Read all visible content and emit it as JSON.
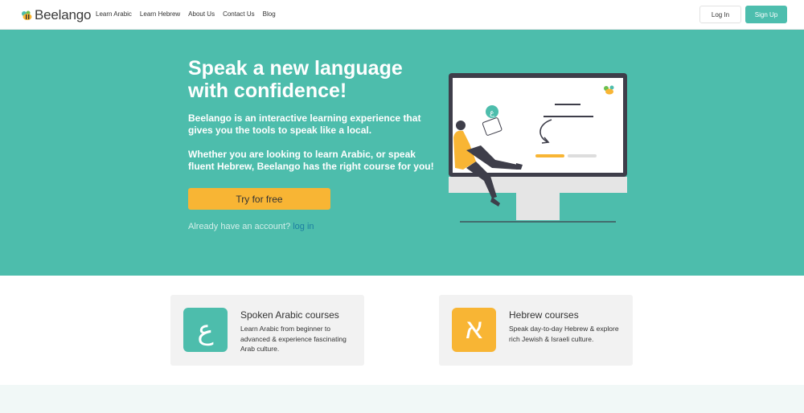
{
  "brand": {
    "name": "Beelango"
  },
  "nav": {
    "links": [
      "Learn Arabic",
      "Learn Hebrew",
      "About Us",
      "Contact Us",
      "Blog"
    ],
    "login_label": "Log In",
    "signup_label": "Sign Up"
  },
  "hero": {
    "title": "Speak a new language with confidence!",
    "paragraph1": "Beelango is an interactive learning experience that gives you the tools to speak like a local.",
    "paragraph2": "Whether you are looking to learn Arabic, or speak fluent Hebrew, Beelango has the right course for you!",
    "cta_label": "Try for free",
    "account_text": "Already have an account?",
    "login_link": "log in",
    "illustration_glyph": "ع"
  },
  "courses": [
    {
      "glyph": "ع",
      "title": "Spoken Arabic courses",
      "description": "Learn Arabic from beginner to advanced & experience fascinating Arab culture."
    },
    {
      "glyph": "א",
      "title": "Hebrew courses",
      "description": "Speak day-to-day Hebrew & explore rich Jewish & Israeli culture."
    }
  ],
  "colors": {
    "teal": "#4dbdac",
    "yellow": "#f8b534",
    "link_blue": "#1c7fa1"
  }
}
